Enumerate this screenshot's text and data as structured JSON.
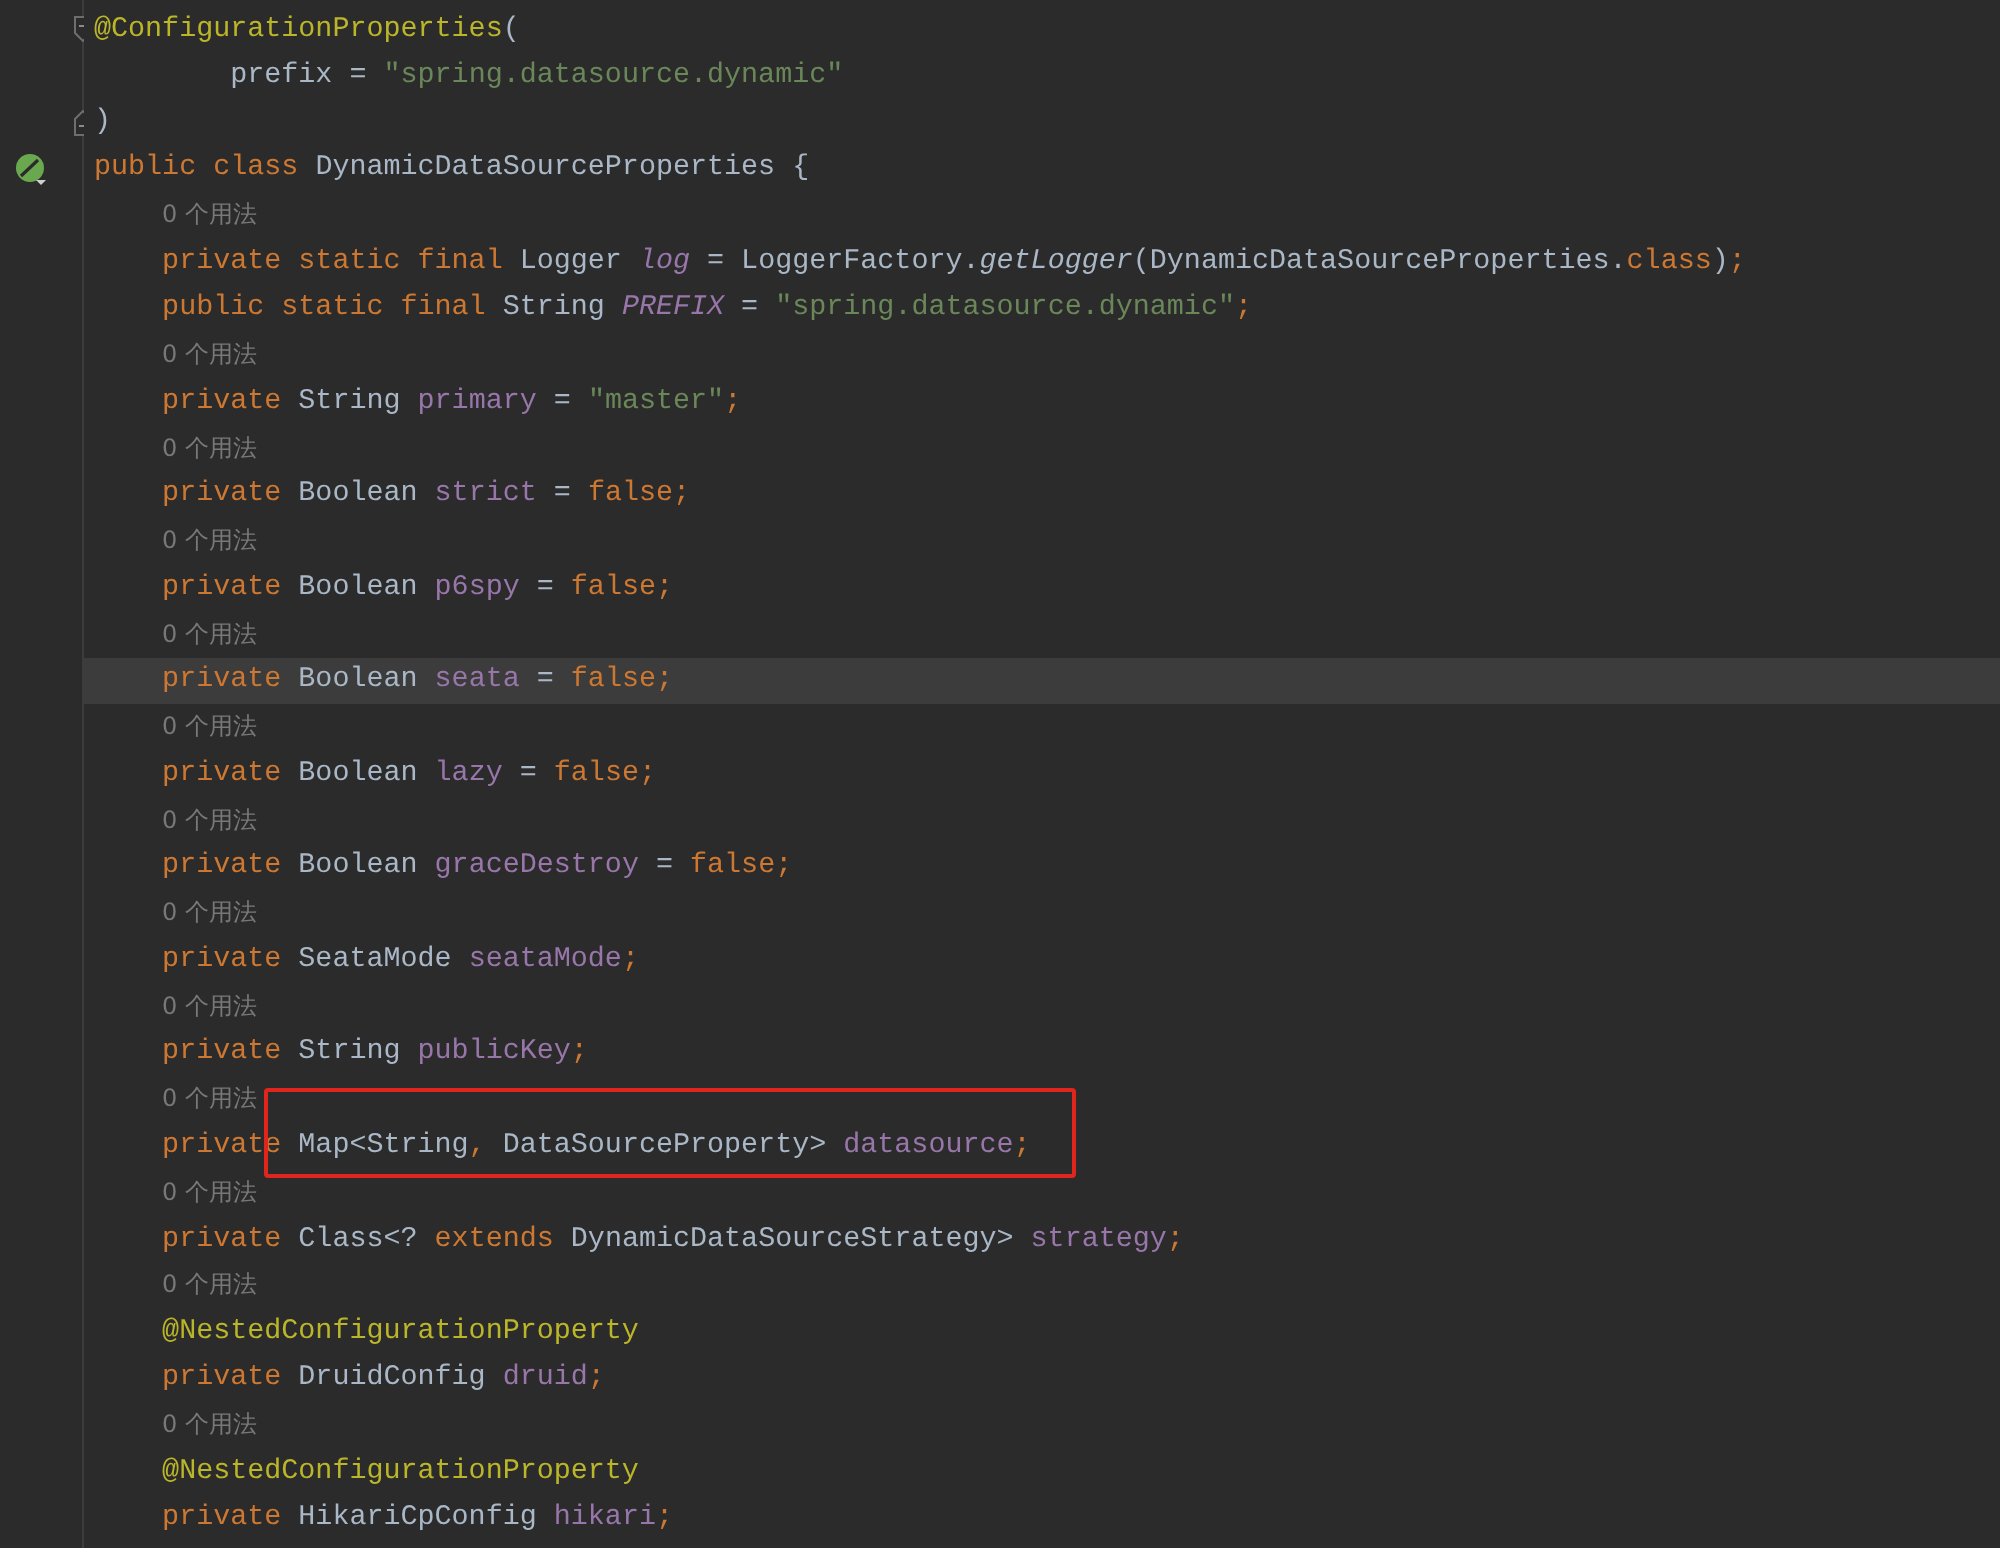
{
  "editor": {
    "lines": [
      {
        "kind": "code",
        "current": false,
        "outlined": false,
        "gutter_icon": {
          "kind": "fold-start"
        },
        "tokens": [
          {
            "kind": "annotation",
            "text": "@ConfigurationProperties"
          },
          {
            "kind": "plain",
            "text": "("
          }
        ]
      },
      {
        "kind": "code",
        "current": false,
        "outlined": false,
        "tokens": [
          {
            "kind": "plain",
            "text": "        prefix = "
          },
          {
            "kind": "string",
            "text": "\"spring.datasource.dynamic\""
          }
        ]
      },
      {
        "kind": "code",
        "current": false,
        "outlined": false,
        "gutter_icon": {
          "kind": "fold-end"
        },
        "tokens": [
          {
            "kind": "plain",
            "text": ")"
          }
        ]
      },
      {
        "kind": "code",
        "current": false,
        "outlined": false,
        "gutter_icon": {
          "kind": "bean"
        },
        "tokens": [
          {
            "kind": "kw",
            "text": "public class "
          },
          {
            "kind": "plain",
            "text": "DynamicDataSourceProperties {"
          }
        ]
      },
      {
        "kind": "hint",
        "text": "0 个用法"
      },
      {
        "kind": "code",
        "current": false,
        "outlined": false,
        "tokens": [
          {
            "kind": "kw",
            "text": "    private static final "
          },
          {
            "kind": "plain",
            "text": "Logger "
          },
          {
            "kind": "static",
            "text": "log"
          },
          {
            "kind": "plain",
            "text": " = LoggerFactory."
          },
          {
            "kind": "method",
            "text": "getLogger"
          },
          {
            "kind": "plain",
            "text": "(DynamicDataSourceProperties."
          },
          {
            "kind": "kw",
            "text": "class"
          },
          {
            "kind": "plain",
            "text": ")"
          },
          {
            "kind": "kw",
            "text": ";"
          }
        ]
      },
      {
        "kind": "code",
        "current": false,
        "outlined": false,
        "tokens": [
          {
            "kind": "kw",
            "text": "    public static final "
          },
          {
            "kind": "plain",
            "text": "String "
          },
          {
            "kind": "static",
            "text": "PREFIX"
          },
          {
            "kind": "plain",
            "text": " = "
          },
          {
            "kind": "string",
            "text": "\"spring.datasource.dynamic\""
          },
          {
            "kind": "kw",
            "text": ";"
          }
        ]
      },
      {
        "kind": "hint",
        "text": "0 个用法"
      },
      {
        "kind": "code",
        "current": false,
        "outlined": false,
        "tokens": [
          {
            "kind": "kw",
            "text": "    private "
          },
          {
            "kind": "plain",
            "text": "String "
          },
          {
            "kind": "field",
            "text": "primary"
          },
          {
            "kind": "plain",
            "text": " = "
          },
          {
            "kind": "string",
            "text": "\"master\""
          },
          {
            "kind": "kw",
            "text": ";"
          }
        ]
      },
      {
        "kind": "hint",
        "text": "0 个用法"
      },
      {
        "kind": "code",
        "current": false,
        "outlined": false,
        "tokens": [
          {
            "kind": "kw",
            "text": "    private "
          },
          {
            "kind": "plain",
            "text": "Boolean "
          },
          {
            "kind": "field",
            "text": "strict"
          },
          {
            "kind": "plain",
            "text": " = "
          },
          {
            "kind": "kw",
            "text": "false;"
          }
        ]
      },
      {
        "kind": "hint",
        "text": "0 个用法"
      },
      {
        "kind": "code",
        "current": false,
        "outlined": false,
        "tokens": [
          {
            "kind": "kw",
            "text": "    private "
          },
          {
            "kind": "plain",
            "text": "Boolean "
          },
          {
            "kind": "field",
            "text": "p6spy"
          },
          {
            "kind": "plain",
            "text": " = "
          },
          {
            "kind": "kw",
            "text": "false;"
          }
        ]
      },
      {
        "kind": "hint",
        "text": "0 个用法"
      },
      {
        "kind": "code",
        "current": true,
        "outlined": false,
        "tokens": [
          {
            "kind": "kw",
            "text": "    private "
          },
          {
            "kind": "plain",
            "text": "Boolean "
          },
          {
            "kind": "field",
            "text": "seata"
          },
          {
            "kind": "plain",
            "text": " = "
          },
          {
            "kind": "kw",
            "text": "false;"
          }
        ]
      },
      {
        "kind": "hint",
        "text": "0 个用法"
      },
      {
        "kind": "code",
        "current": false,
        "outlined": false,
        "tokens": [
          {
            "kind": "kw",
            "text": "    private "
          },
          {
            "kind": "plain",
            "text": "Boolean "
          },
          {
            "kind": "field",
            "text": "lazy"
          },
          {
            "kind": "plain",
            "text": " = "
          },
          {
            "kind": "kw",
            "text": "false;"
          }
        ]
      },
      {
        "kind": "hint",
        "text": "0 个用法"
      },
      {
        "kind": "code",
        "current": false,
        "outlined": false,
        "tokens": [
          {
            "kind": "kw",
            "text": "    private "
          },
          {
            "kind": "plain",
            "text": "Boolean "
          },
          {
            "kind": "field",
            "text": "graceDestroy"
          },
          {
            "kind": "plain",
            "text": " = "
          },
          {
            "kind": "kw",
            "text": "false;"
          }
        ]
      },
      {
        "kind": "hint",
        "text": "0 个用法"
      },
      {
        "kind": "code",
        "current": false,
        "outlined": false,
        "tokens": [
          {
            "kind": "kw",
            "text": "    private "
          },
          {
            "kind": "plain",
            "text": "SeataMode "
          },
          {
            "kind": "field",
            "text": "seataMode"
          },
          {
            "kind": "kw",
            "text": ";"
          }
        ]
      },
      {
        "kind": "hint",
        "text": "0 个用法"
      },
      {
        "kind": "code",
        "current": false,
        "outlined": false,
        "tokens": [
          {
            "kind": "kw",
            "text": "    private "
          },
          {
            "kind": "plain",
            "text": "String "
          },
          {
            "kind": "field",
            "text": "publicKey"
          },
          {
            "kind": "kw",
            "text": ";"
          }
        ]
      },
      {
        "kind": "hint",
        "text": "0 个用法"
      },
      {
        "kind": "code",
        "current": false,
        "outlined": true,
        "tokens": [
          {
            "kind": "kw",
            "text": "    private "
          },
          {
            "kind": "plain",
            "text": "Map<String"
          },
          {
            "kind": "kw",
            "text": ", "
          },
          {
            "kind": "plain",
            "text": "DataSourceProperty> "
          },
          {
            "kind": "field",
            "text": "datasource"
          },
          {
            "kind": "kw",
            "text": ";"
          }
        ]
      },
      {
        "kind": "hint",
        "text": "0 个用法"
      },
      {
        "kind": "code",
        "current": false,
        "outlined": false,
        "tokens": [
          {
            "kind": "kw",
            "text": "    private "
          },
          {
            "kind": "plain",
            "text": "Class<? "
          },
          {
            "kind": "kw",
            "text": "extends "
          },
          {
            "kind": "plain",
            "text": "DynamicDataSourceStrategy> "
          },
          {
            "kind": "field",
            "text": "strategy"
          },
          {
            "kind": "kw",
            "text": ";"
          }
        ]
      },
      {
        "kind": "hint",
        "text": "0 个用法"
      },
      {
        "kind": "code",
        "current": false,
        "outlined": false,
        "tokens": [
          {
            "kind": "annotation",
            "text": "    @NestedConfigurationProperty"
          }
        ]
      },
      {
        "kind": "code",
        "current": false,
        "outlined": false,
        "tokens": [
          {
            "kind": "kw",
            "text": "    private "
          },
          {
            "kind": "plain",
            "text": "DruidConfig "
          },
          {
            "kind": "field",
            "text": "druid"
          },
          {
            "kind": "kw",
            "text": ";"
          }
        ]
      },
      {
        "kind": "hint",
        "text": "0 个用法"
      },
      {
        "kind": "code",
        "current": false,
        "outlined": false,
        "tokens": [
          {
            "kind": "annotation",
            "text": "    @NestedConfigurationProperty"
          }
        ]
      },
      {
        "kind": "code",
        "current": false,
        "outlined": false,
        "tokens": [
          {
            "kind": "kw",
            "text": "    private "
          },
          {
            "kind": "plain",
            "text": "HikariCpConfig "
          },
          {
            "kind": "field",
            "text": "hikari"
          },
          {
            "kind": "kw",
            "text": ";"
          }
        ]
      }
    ]
  }
}
